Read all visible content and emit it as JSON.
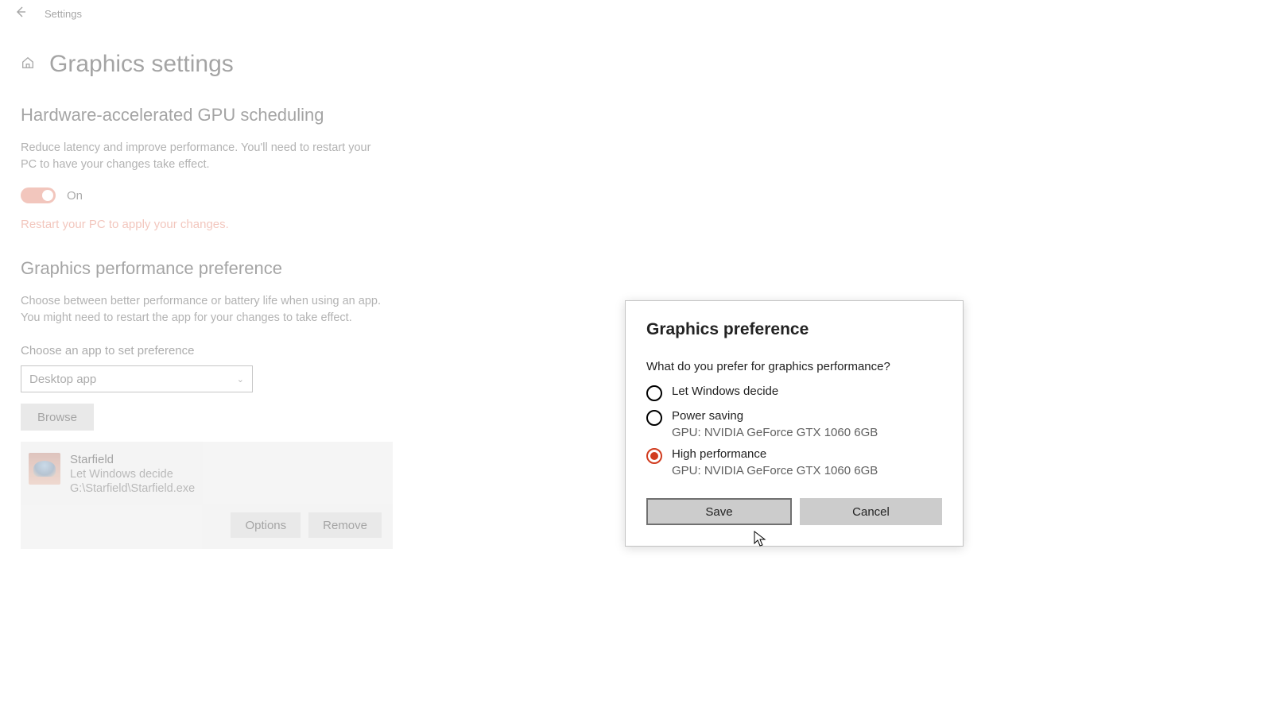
{
  "titlebar": {
    "label": "Settings"
  },
  "page": {
    "title": "Graphics settings"
  },
  "gpu_scheduling": {
    "heading": "Hardware-accelerated GPU scheduling",
    "description": "Reduce latency and improve performance. You'll need to restart your PC to have your changes take effect.",
    "toggle_state": "On",
    "restart_message": "Restart your PC to apply your changes."
  },
  "perf_pref": {
    "heading": "Graphics performance preference",
    "description": "Choose between better performance or battery life when using an app. You might need to restart the app for your changes to take effect.",
    "choose_label": "Choose an app to set preference",
    "dropdown_value": "Desktop app",
    "browse_label": "Browse"
  },
  "app": {
    "name": "Starfield",
    "pref": "Let Windows decide",
    "path": "G:\\Starfield\\Starfield.exe",
    "options_label": "Options",
    "remove_label": "Remove"
  },
  "dialog": {
    "title": "Graphics preference",
    "question": "What do you prefer for graphics performance?",
    "options": [
      {
        "label": "Let Windows decide",
        "sub": "",
        "selected": false
      },
      {
        "label": "Power saving",
        "sub": "GPU: NVIDIA GeForce GTX 1060 6GB",
        "selected": false
      },
      {
        "label": "High performance",
        "sub": "GPU: NVIDIA GeForce GTX 1060 6GB",
        "selected": true
      }
    ],
    "save_label": "Save",
    "cancel_label": "Cancel"
  }
}
